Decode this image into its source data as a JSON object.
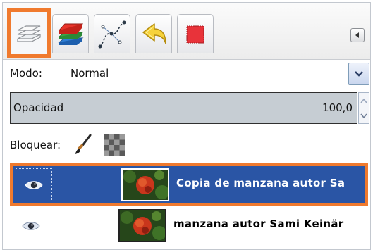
{
  "tabs": [
    {
      "name": "layers",
      "icon": "layers-icon",
      "active": true
    },
    {
      "name": "channels",
      "icon": "channels-icon",
      "active": false
    },
    {
      "name": "paths",
      "icon": "paths-icon",
      "active": false
    },
    {
      "name": "undo-history",
      "icon": "undo-icon",
      "active": false
    },
    {
      "name": "colors",
      "icon": "red-square-icon",
      "active": false
    }
  ],
  "mode": {
    "label": "Modo:",
    "value": "Normal"
  },
  "opacity": {
    "label": "Opacidad",
    "value": "100,0"
  },
  "lock": {
    "label": "Bloquear:"
  },
  "layers": [
    {
      "name": "Copia de manzana autor Sa",
      "selected": true
    },
    {
      "name": "manzana autor Sami Keinär",
      "selected": false
    }
  ],
  "colors": {
    "accent": "#f07a2e",
    "selection": "#2a55a5",
    "opacity_bar": "#c6cdd3"
  }
}
